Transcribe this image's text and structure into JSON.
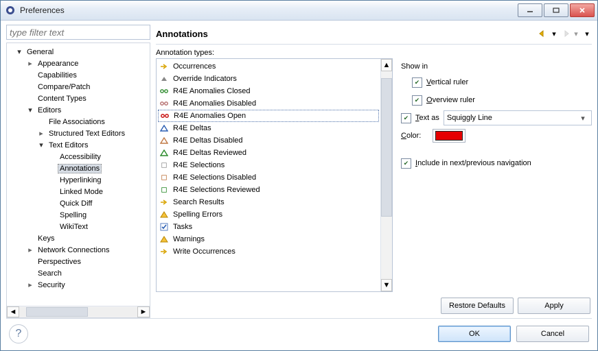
{
  "window": {
    "title": "Preferences"
  },
  "filter": {
    "placeholder": "type filter text"
  },
  "tree": [
    {
      "depth": 0,
      "expand": "open",
      "label": "General"
    },
    {
      "depth": 1,
      "expand": "closed",
      "label": "Appearance"
    },
    {
      "depth": 1,
      "expand": "none",
      "label": "Capabilities"
    },
    {
      "depth": 1,
      "expand": "none",
      "label": "Compare/Patch"
    },
    {
      "depth": 1,
      "expand": "none",
      "label": "Content Types"
    },
    {
      "depth": 1,
      "expand": "open",
      "label": "Editors"
    },
    {
      "depth": 2,
      "expand": "none",
      "label": "File Associations"
    },
    {
      "depth": 2,
      "expand": "closed",
      "label": "Structured Text Editors"
    },
    {
      "depth": 2,
      "expand": "open",
      "label": "Text Editors"
    },
    {
      "depth": 3,
      "expand": "none",
      "label": "Accessibility"
    },
    {
      "depth": 3,
      "expand": "none",
      "label": "Annotations",
      "selected": true
    },
    {
      "depth": 3,
      "expand": "none",
      "label": "Hyperlinking"
    },
    {
      "depth": 3,
      "expand": "none",
      "label": "Linked Mode"
    },
    {
      "depth": 3,
      "expand": "none",
      "label": "Quick Diff"
    },
    {
      "depth": 3,
      "expand": "none",
      "label": "Spelling"
    },
    {
      "depth": 3,
      "expand": "none",
      "label": "WikiText"
    },
    {
      "depth": 1,
      "expand": "none",
      "label": "Keys"
    },
    {
      "depth": 1,
      "expand": "closed",
      "label": "Network Connections"
    },
    {
      "depth": 1,
      "expand": "none",
      "label": "Perspectives"
    },
    {
      "depth": 1,
      "expand": "none",
      "label": "Search"
    },
    {
      "depth": 1,
      "expand": "closed",
      "label": "Security"
    }
  ],
  "page": {
    "title": "Annotations",
    "types_label": "Annotation types:"
  },
  "types": [
    {
      "icon": "arrow-right-gold",
      "label": "Occurrences"
    },
    {
      "icon": "triangle-up",
      "label": "Override Indicators"
    },
    {
      "icon": "link",
      "label": "R4E Anomalies Closed"
    },
    {
      "icon": "link-dim",
      "label": "R4E Anomalies Disabled"
    },
    {
      "icon": "link-red",
      "label": "R4E Anomalies Open",
      "selected": true
    },
    {
      "icon": "delta",
      "label": "R4E Deltas"
    },
    {
      "icon": "delta-dim",
      "label": "R4E Deltas Disabled"
    },
    {
      "icon": "delta-green",
      "label": "R4E Deltas Reviewed"
    },
    {
      "icon": "box",
      "label": "R4E Selections"
    },
    {
      "icon": "box-dim",
      "label": "R4E Selections Disabled"
    },
    {
      "icon": "box-green",
      "label": "R4E Selections Reviewed"
    },
    {
      "icon": "arrow-right-gold",
      "label": "Search Results"
    },
    {
      "icon": "warn",
      "label": "Spelling Errors"
    },
    {
      "icon": "check-blue",
      "label": "Tasks"
    },
    {
      "icon": "warn",
      "label": "Warnings"
    },
    {
      "icon": "arrow-right-gold",
      "label": "Write Occurrences"
    }
  ],
  "options": {
    "show_in": "Show in",
    "vertical_ruler": {
      "label": "Vertical ruler",
      "checked": true,
      "u": 0
    },
    "overview_ruler": {
      "label": "Overview ruler",
      "checked": true,
      "u": 0
    },
    "text_as": {
      "label": "Text as",
      "checked": true,
      "u": 0,
      "value": "Squiggly Line"
    },
    "color": {
      "label": "Color:",
      "u": 0,
      "value": "#e60000"
    },
    "include_nav": {
      "label": "Include in next/previous navigation",
      "checked": true,
      "u": 0
    }
  },
  "buttons": {
    "restore": "Restore Defaults",
    "apply": "Apply",
    "ok": "OK",
    "cancel": "Cancel"
  }
}
